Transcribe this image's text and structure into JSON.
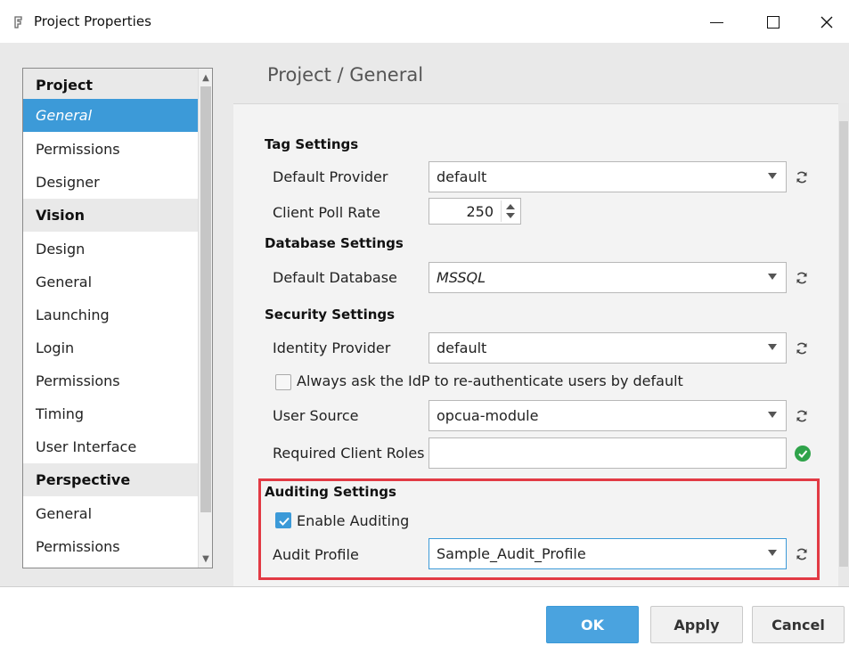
{
  "window": {
    "title": "Project Properties",
    "minimize_label": "minimize",
    "maximize_label": "maximize",
    "close_label": "close"
  },
  "sidebar": {
    "items": [
      {
        "label": "Project",
        "kind": "header"
      },
      {
        "label": "General",
        "kind": "item",
        "selected": true
      },
      {
        "label": "Permissions",
        "kind": "item"
      },
      {
        "label": "Designer",
        "kind": "item"
      },
      {
        "label": "Vision",
        "kind": "header"
      },
      {
        "label": "Design",
        "kind": "item"
      },
      {
        "label": "General",
        "kind": "item"
      },
      {
        "label": "Launching",
        "kind": "item"
      },
      {
        "label": "Login",
        "kind": "item"
      },
      {
        "label": "Permissions",
        "kind": "item"
      },
      {
        "label": "Timing",
        "kind": "item"
      },
      {
        "label": "User Interface",
        "kind": "item"
      },
      {
        "label": "Perspective",
        "kind": "header"
      },
      {
        "label": "General",
        "kind": "item"
      },
      {
        "label": "Permissions",
        "kind": "item"
      }
    ]
  },
  "main": {
    "breadcrumb": "Project / General",
    "tag_settings": {
      "title": "Tag Settings",
      "default_provider_label": "Default Provider",
      "default_provider_value": "default",
      "client_poll_rate_label": "Client Poll Rate",
      "client_poll_rate_value": "250"
    },
    "database_settings": {
      "title": "Database Settings",
      "default_database_label": "Default Database",
      "default_database_value": "MSSQL"
    },
    "security_settings": {
      "title": "Security Settings",
      "identity_provider_label": "Identity Provider",
      "identity_provider_value": "default",
      "reauth_label": "Always ask the IdP to re-authenticate users by default",
      "reauth_checked": false,
      "user_source_label": "User Source",
      "user_source_value": "opcua-module",
      "required_roles_label": "Required Client Roles",
      "required_roles_value": ""
    },
    "auditing_settings": {
      "title": "Auditing Settings",
      "enable_label": "Enable Auditing",
      "enable_checked": true,
      "audit_profile_label": "Audit Profile",
      "audit_profile_value": "Sample_Audit_Profile"
    }
  },
  "footer": {
    "ok_label": "OK",
    "apply_label": "Apply",
    "cancel_label": "Cancel"
  },
  "colors": {
    "accent": "#3c9ad8",
    "highlight": "#e23a44",
    "valid": "#2fa34a"
  }
}
